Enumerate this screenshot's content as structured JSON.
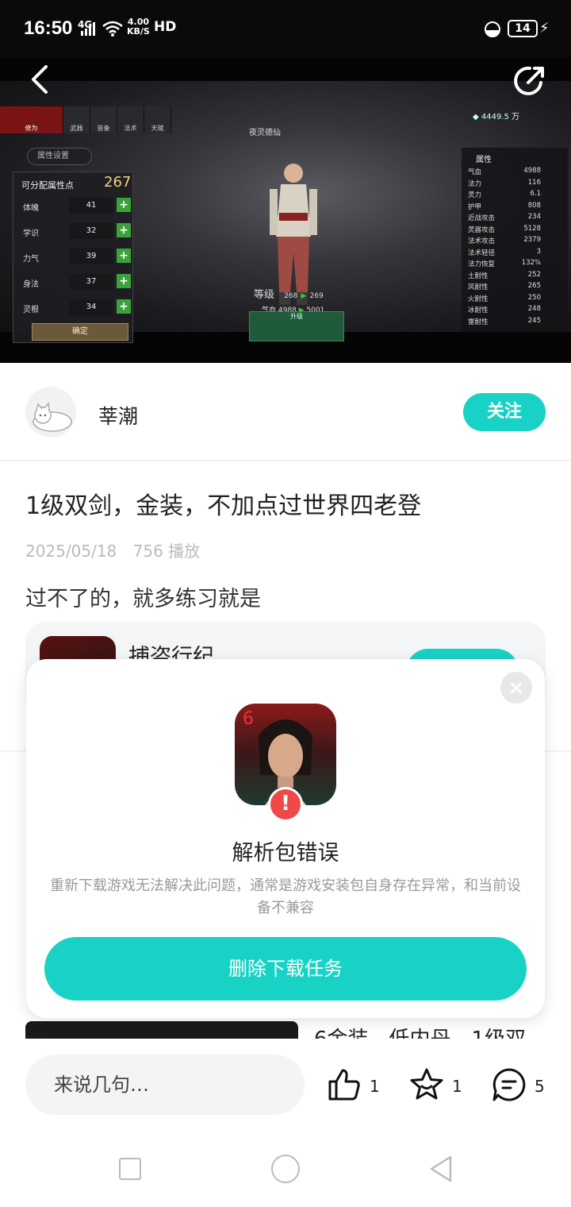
{
  "status_bar": {
    "time": "16:50",
    "network": "4G",
    "speed_value": "4.00",
    "speed_unit": "KB/S",
    "hd": "HD",
    "battery": "14",
    "icons": [
      "signal-icon",
      "wifi-icon",
      "moon-icon",
      "battery-icon",
      "charging-icon"
    ]
  },
  "video": {
    "game_ui": {
      "tabs": [
        "修为",
        "武器",
        "装备",
        "法术",
        "天赋"
      ],
      "setting_pill": "属性设置",
      "points_label": "可分配属性点",
      "points_value": "267",
      "attributes": [
        {
          "name": "体魄",
          "value": "41"
        },
        {
          "name": "学识",
          "value": "32"
        },
        {
          "name": "力气",
          "value": "39"
        },
        {
          "name": "身法",
          "value": "37"
        },
        {
          "name": "灵根",
          "value": "34"
        }
      ],
      "confirm": "确定",
      "character_title": "夜灵德仙",
      "level_label": "等级",
      "level_from": "268",
      "level_to": "269",
      "hp_label": "气血",
      "hp_from": "4988",
      "hp_to": "5001",
      "upgrade_label": "升级",
      "gem_value": "4449.5 万",
      "stats_title": "属性",
      "stats": [
        {
          "k": "气血",
          "v": "4988"
        },
        {
          "k": "法力",
          "v": "116"
        },
        {
          "k": "灵力",
          "v": "6.1"
        },
        {
          "k": "护甲",
          "v": "808"
        },
        {
          "k": "近战攻击",
          "v": "234"
        },
        {
          "k": "灵器攻击",
          "v": "5128"
        },
        {
          "k": "法术攻击",
          "v": "2379"
        },
        {
          "k": "法术轻径",
          "v": "3"
        },
        {
          "k": "法力恢复",
          "v": "132%"
        },
        {
          "k": "土耐性",
          "v": "252"
        },
        {
          "k": "风耐性",
          "v": "265"
        },
        {
          "k": "火耐性",
          "v": "250"
        },
        {
          "k": "冰耐性",
          "v": "248"
        },
        {
          "k": "雷耐性",
          "v": "245"
        }
      ]
    }
  },
  "author": {
    "name": "莘潮",
    "follow_label": "关注"
  },
  "post": {
    "title": "1级双剑，金装，不加点过世界四老登",
    "date": "2025/05/18",
    "plays": "756 播放",
    "description": "过不了的，就多练习就是"
  },
  "game_card": {
    "name": "捕盗行纪"
  },
  "related": {
    "title": "6金装，低内丹，1级双"
  },
  "modal": {
    "title": "解析包错误",
    "message": "重新下载游戏无法解决此问题，通常是游戏安装包自身存在异常，和当前设备不兼容",
    "button": "删除下载任务",
    "warn_symbol": "!"
  },
  "action_bar": {
    "comment_placeholder": "来说几句…",
    "likes": "1",
    "favorites": "1",
    "comments": "5"
  },
  "colors": {
    "accent": "#18d3c5",
    "warning": "#ef4a4a"
  }
}
